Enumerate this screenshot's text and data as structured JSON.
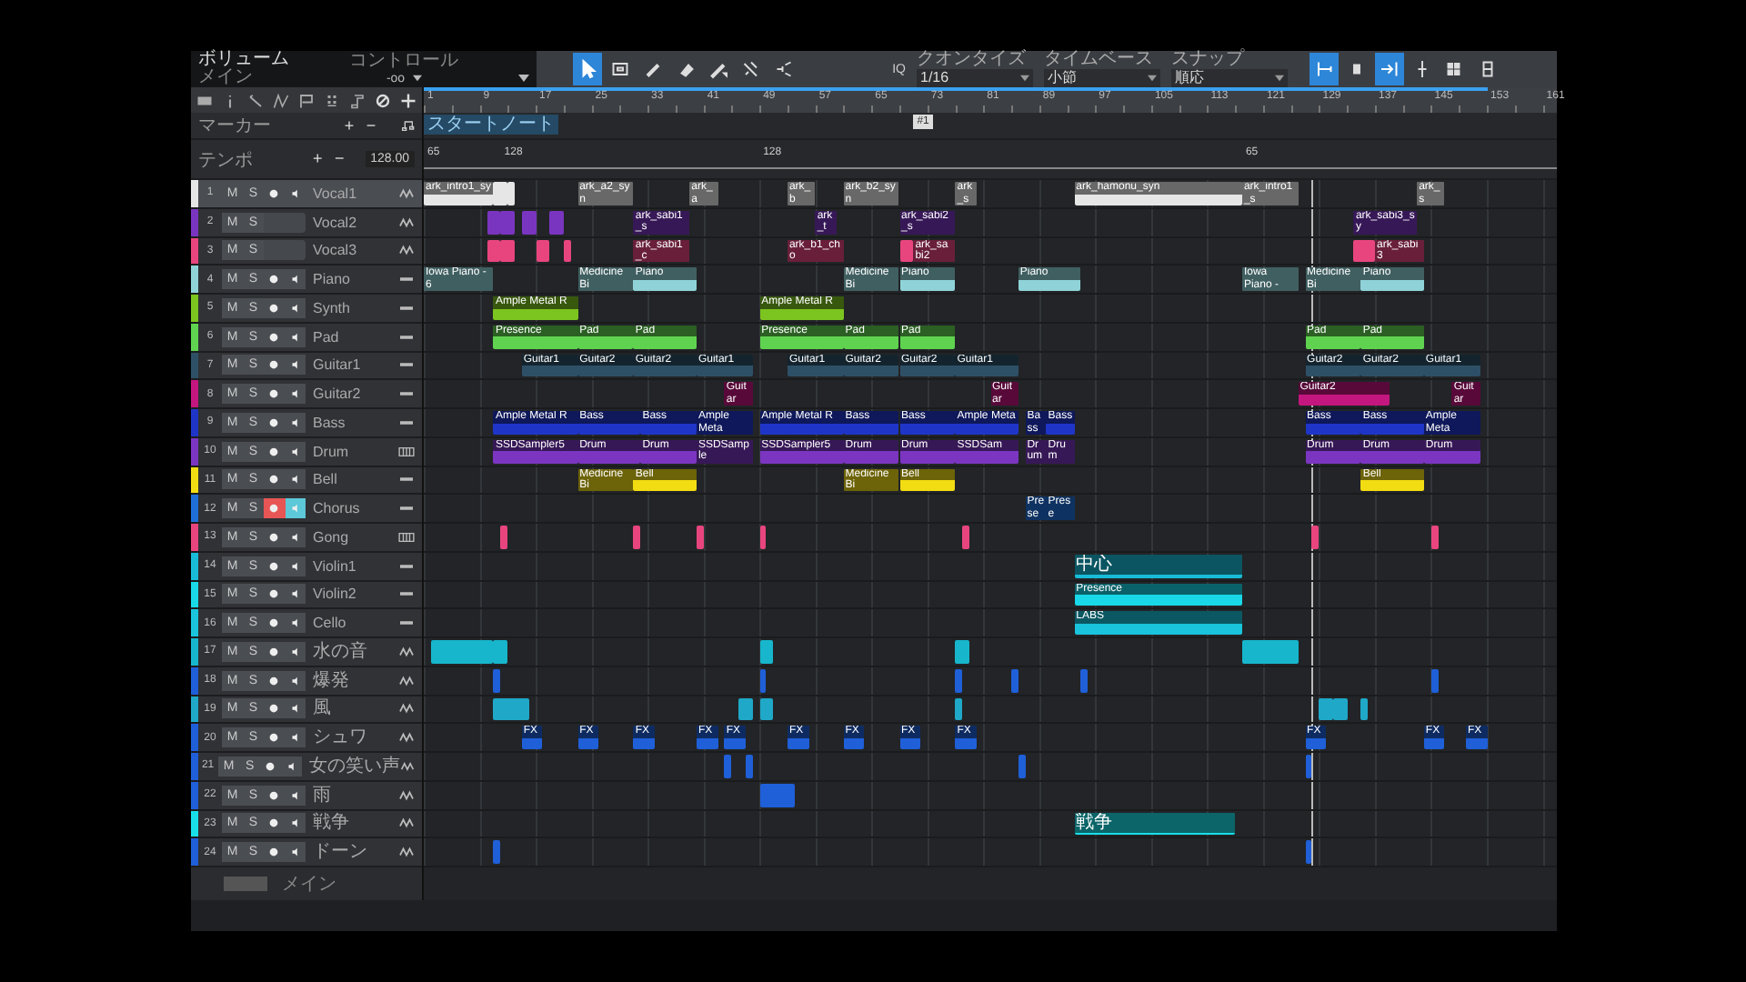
{
  "topbar": {
    "volume_label": "ボリューム",
    "bus": "メイン",
    "volume_value": "-oo",
    "control_label": "コントロール",
    "tools": [
      {
        "kind": "pointer",
        "selected": true
      },
      {
        "kind": "range",
        "selected": false
      },
      {
        "kind": "pencil",
        "selected": false
      },
      {
        "kind": "eraser",
        "selected": false
      },
      {
        "kind": "paint",
        "selected": false
      },
      {
        "kind": "mute",
        "selected": false
      },
      {
        "kind": "listen",
        "selected": false
      }
    ],
    "iq": "IQ",
    "dropdowns": [
      {
        "label": "クオンタイズ",
        "value": "1/16"
      },
      {
        "label": "タイムベース",
        "value": "小節"
      },
      {
        "label": "スナップ",
        "value": "順応"
      }
    ],
    "toggles": [
      {
        "kind": "loop-start",
        "selected": true
      },
      {
        "kind": "box",
        "selected": false
      },
      {
        "kind": "follow",
        "selected": true
      },
      {
        "kind": "cursor",
        "selected": false
      },
      {
        "kind": "grid",
        "selected": false
      },
      {
        "kind": "clip",
        "selected": false
      }
    ]
  },
  "marker_row": {
    "label": "マーカー",
    "add": "+",
    "remove": "−"
  },
  "tempo_row": {
    "label": "テンポ",
    "add": "+",
    "remove": "−",
    "value": "128.00"
  },
  "ruler": {
    "labels": [
      "1",
      "9",
      "17",
      "25",
      "33",
      "41",
      "49",
      "57",
      "65",
      "73",
      "81",
      "89",
      "97",
      "105",
      "113",
      "121",
      "129",
      "137",
      "145",
      "153",
      "161"
    ]
  },
  "markers": [
    {
      "label": "スタートノート",
      "kind": "start"
    },
    {
      "label": "#1",
      "kind": "flag"
    }
  ],
  "tempo_points": [
    {
      "label": "65"
    },
    {
      "label": "128"
    },
    {
      "label": "128"
    },
    {
      "label": "65"
    }
  ],
  "tracks": [
    {
      "number": "1",
      "name": "Vocal1",
      "color": "#e6e6e6",
      "kind": "audio",
      "selected": true,
      "mute": {
        "label": "M",
        "on": false
      },
      "solo": {
        "label": "S",
        "on": false
      },
      "record": false,
      "monitor": false,
      "clips": [
        "ark_intro1_sy",
        "ark_a2_syn",
        "ark_a",
        "ark_b",
        "ark_b2_syn",
        "ark_s",
        "ark_hamonu_syn",
        "ark_intro1_s",
        "ark_s"
      ]
    },
    {
      "number": "2",
      "name": "Vocal2",
      "color": "#7a35c0",
      "kind": "audio",
      "selected": false,
      "mute": {
        "label": "M",
        "on": false
      },
      "solo": {
        "label": "S",
        "on": false
      },
      "clips": [
        "ark_sabi1_s",
        "ark_t",
        "ark_sabi2_s",
        "ark_sabi3_sy"
      ]
    },
    {
      "number": "3",
      "name": "Vocal3",
      "color": "#e8457e",
      "kind": "audio",
      "selected": false,
      "mute": {
        "label": "M",
        "on": false
      },
      "solo": {
        "label": "S",
        "on": false
      },
      "clips": [
        "ark_sabi1_c",
        "ark_b1_cho",
        "ark_sabi2",
        "ark_sabi3"
      ]
    },
    {
      "number": "4",
      "name": "Piano",
      "color": "#8fd3d8",
      "kind": "instrument",
      "selected": false,
      "mute": {
        "label": "M",
        "on": false
      },
      "solo": {
        "label": "S",
        "on": false
      },
      "record": false,
      "monitor": false,
      "clips": [
        "Iowa Piano - 6",
        "Medicine Bi",
        "Piano",
        "Medicine Bi",
        "Piano",
        "Piano",
        "Iowa Piano -",
        "Medicine Bi",
        "Piano"
      ]
    },
    {
      "number": "5",
      "name": "Synth",
      "color": "#7cc41f",
      "kind": "instrument",
      "selected": false,
      "mute": {
        "label": "M",
        "on": false
      },
      "solo": {
        "label": "S",
        "on": false
      },
      "record": false,
      "monitor": false,
      "clips": [
        "Ample Metal R",
        "Ample Metal R"
      ]
    },
    {
      "number": "6",
      "name": "Pad",
      "color": "#5fd34f",
      "kind": "instrument",
      "selected": false,
      "mute": {
        "label": "M",
        "on": false
      },
      "solo": {
        "label": "S",
        "on": false
      },
      "record": false,
      "monitor": false,
      "clips": [
        "Presence",
        "Pad",
        "Pad",
        "Presence",
        "Pad",
        "Pad",
        "Pad",
        "Pad"
      ]
    },
    {
      "number": "7",
      "name": "Guitar1",
      "color": "#2e5066",
      "kind": "instrument",
      "selected": false,
      "mute": {
        "label": "M",
        "on": false
      },
      "solo": {
        "label": "S",
        "on": false
      },
      "record": false,
      "monitor": false,
      "clips": [
        "Guitar1",
        "Guitar2",
        "Guitar2",
        "Guitar1",
        "Guitar1",
        "Guitar2",
        "Guitar2",
        "Guitar1",
        "Guitar2",
        "Guitar2",
        "Guitar1"
      ]
    },
    {
      "number": "8",
      "name": "Guitar2",
      "color": "#c4167f",
      "kind": "instrument",
      "selected": false,
      "mute": {
        "label": "M",
        "on": false
      },
      "solo": {
        "label": "S",
        "on": false
      },
      "record": false,
      "monitor": false,
      "clips": [
        "Guitar",
        "Guitar",
        "Guitar2",
        "Guitar"
      ]
    },
    {
      "number": "9",
      "name": "Bass",
      "color": "#1f35c8",
      "kind": "instrument",
      "selected": false,
      "mute": {
        "label": "M",
        "on": false
      },
      "solo": {
        "label": "S",
        "on": false
      },
      "record": false,
      "monitor": false,
      "clips": [
        "Ample Metal R",
        "Bass",
        "Bass",
        "Ample Meta",
        "Ample Metal R",
        "Bass",
        "Bass",
        "Ample Meta",
        "Bass",
        "Bass",
        "Bass",
        "Bass",
        "Ample Meta"
      ]
    },
    {
      "number": "10",
      "name": "Drum",
      "color": "#7b35c0",
      "kind": "drum",
      "selected": false,
      "mute": {
        "label": "M",
        "on": false
      },
      "solo": {
        "label": "S",
        "on": false
      },
      "record": false,
      "monitor": false,
      "clips": [
        "SSDSampler5",
        "Drum",
        "Drum",
        "SSDSample",
        "SSDSampler5",
        "Drum",
        "Drum",
        "SSDSam",
        "Drum",
        "Drum",
        "Drum",
        "Drum",
        "Drum"
      ]
    },
    {
      "number": "11",
      "name": "Bell",
      "color": "#f2dc12",
      "kind": "instrument",
      "selected": false,
      "mute": {
        "label": "M",
        "on": false
      },
      "solo": {
        "label": "S",
        "on": false
      },
      "record": false,
      "monitor": false,
      "clips": [
        "Medicine Bi",
        "Bell",
        "Medicine Bi",
        "Bell",
        "Bell"
      ]
    },
    {
      "number": "12",
      "name": "Chorus",
      "color": "#1f6fd8",
      "kind": "instrument",
      "selected": false,
      "mute": {
        "label": "M",
        "on": false
      },
      "solo": {
        "label": "S",
        "on": false
      },
      "record": true,
      "monitor": true,
      "clips": [
        "Prese",
        "Prese"
      ]
    },
    {
      "number": "13",
      "name": "Gong",
      "color": "#e8457e",
      "kind": "drum",
      "selected": false,
      "mute": {
        "label": "M",
        "on": false
      },
      "solo": {
        "label": "S",
        "on": false
      },
      "record": false,
      "monitor": false
    },
    {
      "number": "14",
      "name": "Violin1",
      "color": "#18bcd8",
      "kind": "instrument",
      "selected": false,
      "mute": {
        "label": "M",
        "on": false
      },
      "solo": {
        "label": "S",
        "on": false
      },
      "record": false,
      "monitor": false,
      "clips": [
        "中心"
      ]
    },
    {
      "number": "15",
      "name": "Violin2",
      "color": "#19d8e8",
      "kind": "instrument",
      "selected": false,
      "mute": {
        "label": "M",
        "on": false
      },
      "solo": {
        "label": "S",
        "on": false
      },
      "record": false,
      "monitor": false,
      "clips": [
        "Presence"
      ]
    },
    {
      "number": "16",
      "name": "Cello",
      "color": "#19c4dc",
      "kind": "instrument",
      "selected": false,
      "mute": {
        "label": "M",
        "on": false
      },
      "solo": {
        "label": "S",
        "on": false
      },
      "record": false,
      "monitor": false,
      "clips": [
        "LABS"
      ]
    },
    {
      "number": "17",
      "name": "水の音",
      "color": "#17b6cc",
      "kind": "audio",
      "selected": false,
      "mute": {
        "label": "M",
        "on": false
      },
      "solo": {
        "label": "S",
        "on": false
      },
      "record": false,
      "monitor": false
    },
    {
      "number": "18",
      "name": "爆発",
      "color": "#1f5fd8",
      "kind": "audio",
      "selected": false,
      "mute": {
        "label": "M",
        "on": false
      },
      "solo": {
        "label": "S",
        "on": false
      },
      "record": false,
      "monitor": false
    },
    {
      "number": "19",
      "name": "風",
      "color": "#1fa8c8",
      "kind": "audio",
      "selected": false,
      "mute": {
        "label": "M",
        "on": false
      },
      "solo": {
        "label": "S",
        "on": false
      },
      "record": false,
      "monitor": false
    },
    {
      "number": "20",
      "name": "シュワ",
      "color": "#1f5fd8",
      "kind": "audio",
      "selected": false,
      "mute": {
        "label": "M",
        "on": false
      },
      "solo": {
        "label": "S",
        "on": false
      },
      "record": false,
      "monitor": false,
      "clips": [
        "FX",
        "FX",
        "FX",
        "FX",
        "FX",
        "FX",
        "FX",
        "FX",
        "FX",
        "FX",
        "FX",
        "FX"
      ]
    },
    {
      "number": "21",
      "name": "女の笑い声",
      "color": "#1f5fd8",
      "kind": "audio",
      "selected": false,
      "mute": {
        "label": "M",
        "on": false
      },
      "solo": {
        "label": "S",
        "on": false
      },
      "record": false,
      "monitor": false
    },
    {
      "number": "22",
      "name": "雨",
      "color": "#1f5fd8",
      "kind": "audio",
      "selected": false,
      "mute": {
        "label": "M",
        "on": false
      },
      "solo": {
        "label": "S",
        "on": false
      },
      "record": false,
      "monitor": false
    },
    {
      "number": "23",
      "name": "戦争",
      "color": "#19e0e8",
      "kind": "audio",
      "selected": false,
      "mute": {
        "label": "M",
        "on": false
      },
      "solo": {
        "label": "S",
        "on": false
      },
      "record": false,
      "monitor": false,
      "clips": [
        "戦争"
      ]
    },
    {
      "number": "24",
      "name": "ドーン",
      "color": "#1f5fd8",
      "kind": "audio",
      "selected": false,
      "mute": {
        "label": "M",
        "on": false
      },
      "solo": {
        "label": "S",
        "on": false
      },
      "record": false,
      "monitor": false
    }
  ],
  "main_row": {
    "label": "メイン"
  }
}
